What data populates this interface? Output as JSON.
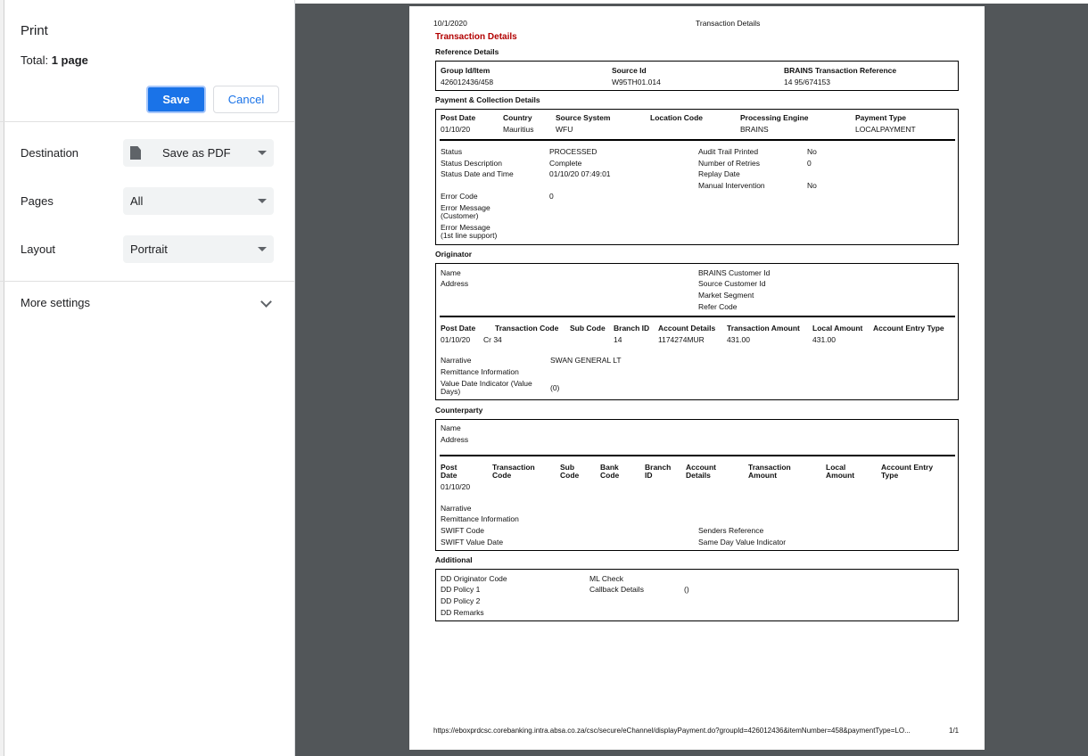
{
  "dialog": {
    "title": "Print",
    "total_prefix": "Total: ",
    "total_value": "1 page",
    "save_label": "Save",
    "cancel_label": "Cancel",
    "destination_label": "Destination",
    "destination_value": "Save as PDF",
    "pages_label": "Pages",
    "pages_value": "All",
    "layout_label": "Layout",
    "layout_value": "Portrait",
    "more_settings_label": "More settings"
  },
  "preview": {
    "header_date": "10/1/2020",
    "header_title": "Transaction Details",
    "doc_title": "Transaction Details",
    "reference": {
      "section": "Reference Details",
      "group_label": "Group Id/Item",
      "group_value": "426012436/458",
      "source_label": "Source Id",
      "source_value": "W95TH01.014",
      "brains_label": "BRAINS Transaction Reference",
      "brains_value": "14  95/674153"
    },
    "payment": {
      "section": "Payment & Collection Details",
      "cols": [
        "Post Date",
        "Country",
        "Source System",
        "Location Code",
        "Processing Engine",
        "Payment Type"
      ],
      "vals": [
        "01/10/20",
        "Mauritius",
        "WFU",
        "",
        "BRAINS",
        "LOCALPAYMENT"
      ],
      "status_label": "Status",
      "status_value": "PROCESSED",
      "status_desc_label": "Status Description",
      "status_desc_value": "Complete",
      "status_dt_label": "Status Date and Time",
      "status_dt_value": "01/10/20 07:49:01",
      "audit_label": "Audit Trail Printed",
      "audit_value": "No",
      "retries_label": "Number of Retries",
      "retries_value": "0",
      "replay_label": "Replay Date",
      "manual_label": "Manual Intervention",
      "manual_value": "No",
      "error_code_label": "Error Code",
      "error_code_value": "0",
      "err_msg_cust_1": "Error Message",
      "err_msg_cust_2": "(Customer)",
      "err_msg_sup_1": "Error Message",
      "err_msg_sup_2": "(1st line support)"
    },
    "originator": {
      "section": "Originator",
      "name_label": "Name",
      "address_label": "Address",
      "brains_cust_label": "BRAINS Customer Id",
      "source_cust_label": "Source Customer Id",
      "market_label": "Market Segment",
      "refer_label": "Refer Code",
      "cols": [
        "Post Date",
        "Transaction Code",
        "Sub Code",
        "Branch ID",
        "Account Details",
        "Transaction Amount",
        "Local Amount",
        "Account Entry Type"
      ],
      "vals": [
        "01/10/20",
        "Cr 34",
        "",
        "14",
        "1174274MUR",
        "431.00",
        "431.00",
        ""
      ],
      "narrative_label": "Narrative",
      "narrative_value": "SWAN GENERAL LT",
      "remit_label": "Remittance Information",
      "vdi_label_1": "Value Date Indicator (Value",
      "vdi_label_2": "Days)",
      "vdi_value": "(0)"
    },
    "counterparty": {
      "section": "Counterparty",
      "name_label": "Name",
      "address_label": "Address",
      "cols1": [
        "Post",
        "Transaction",
        "Sub",
        "Bank",
        "Branch",
        "Account",
        "Transaction",
        "Local",
        "Account Entry"
      ],
      "cols2": [
        "Date",
        "Code",
        "Code",
        "Code",
        "ID",
        "Details",
        "Amount",
        "Amount",
        "Type"
      ],
      "post_date": "01/10/20",
      "narrative_label": "Narrative",
      "remit_label": "Remittance Information",
      "swift_label": "SWIFT Code",
      "swift_vd_label": "SWIFT Value Date",
      "senders_label": "Senders Reference",
      "sameday_label": "Same Day Value Indicator"
    },
    "additional": {
      "section": "Additional",
      "dd_orig_label": "DD Originator Code",
      "dd_p1_label": "DD Policy 1",
      "dd_p2_label": "DD Policy 2",
      "dd_remarks_label": "DD Remarks",
      "ml_label": "ML Check",
      "callback_label": "Callback Details",
      "callback_value": "()"
    },
    "footer_url": "https://eboxprdcsc.corebanking.intra.absa.co.za/csc/secure/eChannel/displayPayment.do?groupId=426012436&itemNumber=458&paymentType=LO...",
    "footer_page": "1/1"
  },
  "colors": {
    "accent": "#1a73e8",
    "preview_bg": "#525659",
    "doc_red": "#b20000"
  }
}
